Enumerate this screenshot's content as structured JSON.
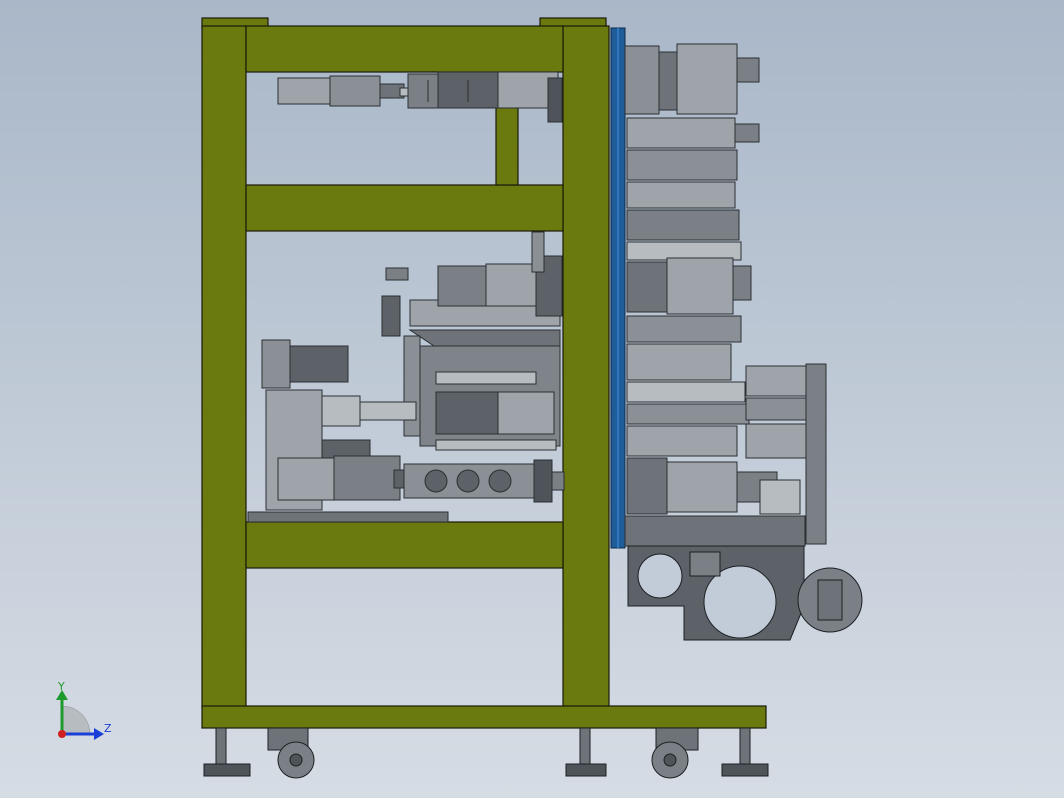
{
  "viewport": {
    "axes": {
      "y_label": "Y",
      "z_label": "Z",
      "y_color": "#1c9a2c",
      "z_color": "#1a3fd8",
      "origin_color": "#d02020"
    }
  },
  "colors": {
    "frame": "#6b7a0e",
    "frame_edge": "#1a1a0a",
    "plate": "#1f5c9a",
    "machinery": "#9ea4aa",
    "machinery_dark": "#4e5459",
    "background_top": "#a9b7c8",
    "background_bottom": "#d6dce4"
  },
  "components": [
    "frame-left-column-icon",
    "frame-right-column-icon",
    "top-motor-assembly-icon",
    "mid-motor-assembly-icon",
    "lower-motor-assembly-icon",
    "mounting-plate-icon",
    "gearbox-plate-icon",
    "caster-wheel-icon",
    "leveling-foot-icon"
  ]
}
